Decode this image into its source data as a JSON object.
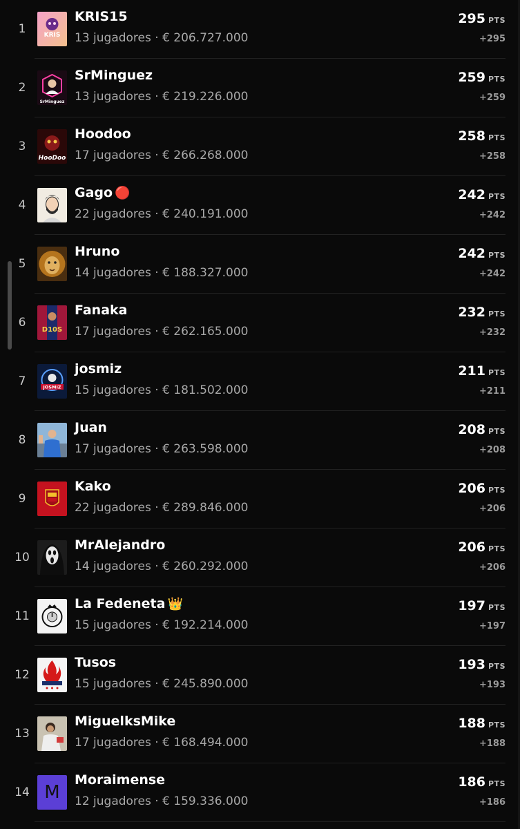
{
  "colors": {
    "background": "#0a0a0a",
    "text": "#ffffff",
    "muted": "#a8a8a8",
    "separator": "#222222"
  },
  "rows": [
    {
      "rank": "1",
      "name": "KRIS15",
      "emoji": "",
      "meta": "13 jugadores · € 206.727.000",
      "points": "295",
      "unit": "PTS",
      "delta": "+295",
      "avatar": "kris15-avatar",
      "avatar_text": "KRIS"
    },
    {
      "rank": "2",
      "name": "SrMinguez",
      "emoji": "",
      "meta": "13 jugadores · € 219.226.000",
      "points": "259",
      "unit": "PTS",
      "delta": "+259",
      "avatar": "srminguez-avatar",
      "avatar_text": "SrMinguez"
    },
    {
      "rank": "3",
      "name": "Hoodoo",
      "emoji": "",
      "meta": "17 jugadores · € 266.268.000",
      "points": "258",
      "unit": "PTS",
      "delta": "+258",
      "avatar": "hoodoo-avatar",
      "avatar_text": "HooDoo"
    },
    {
      "rank": "4",
      "name": "Gago",
      "emoji": "🔴",
      "meta": "22 jugadores · € 240.191.000",
      "points": "242",
      "unit": "PTS",
      "delta": "+242",
      "avatar": "gago-avatar",
      "avatar_text": ""
    },
    {
      "rank": "5",
      "name": "Hruno",
      "emoji": "",
      "meta": "14 jugadores · € 188.327.000",
      "points": "242",
      "unit": "PTS",
      "delta": "+242",
      "avatar": "hruno-avatar",
      "avatar_text": ""
    },
    {
      "rank": "6",
      "name": "Fanaka",
      "emoji": "",
      "meta": "17 jugadores · € 262.165.000",
      "points": "232",
      "unit": "PTS",
      "delta": "+232",
      "avatar": "fanaka-avatar",
      "avatar_text": "D10S"
    },
    {
      "rank": "7",
      "name": "josmiz",
      "emoji": "",
      "meta": "15 jugadores · € 181.502.000",
      "points": "211",
      "unit": "PTS",
      "delta": "+211",
      "avatar": "josmiz-avatar",
      "avatar_text": "JOSMIZ"
    },
    {
      "rank": "8",
      "name": "Juan",
      "emoji": "",
      "meta": "17 jugadores · € 263.598.000",
      "points": "208",
      "unit": "PTS",
      "delta": "+208",
      "avatar": "juan-avatar",
      "avatar_text": ""
    },
    {
      "rank": "9",
      "name": "Kako",
      "emoji": "",
      "meta": "22 jugadores · € 289.846.000",
      "points": "206",
      "unit": "PTS",
      "delta": "+206",
      "avatar": "kako-avatar",
      "avatar_text": ""
    },
    {
      "rank": "10",
      "name": "MrAlejandro",
      "emoji": "",
      "meta": "14 jugadores · € 260.292.000",
      "points": "206",
      "unit": "PTS",
      "delta": "+206",
      "avatar": "mralejandro-avatar",
      "avatar_text": ""
    },
    {
      "rank": "11",
      "name": "La Fedeneta",
      "emoji": "👑",
      "meta": "15 jugadores · € 192.214.000",
      "points": "197",
      "unit": "PTS",
      "delta": "+197",
      "avatar": "lafedeneta-avatar",
      "avatar_text": ""
    },
    {
      "rank": "12",
      "name": "Tusos",
      "emoji": "",
      "meta": "15 jugadores · € 245.890.000",
      "points": "193",
      "unit": "PTS",
      "delta": "+193",
      "avatar": "tusos-avatar",
      "avatar_text": ""
    },
    {
      "rank": "13",
      "name": "MiguelksMike",
      "emoji": "",
      "meta": "17 jugadores · € 168.494.000",
      "points": "188",
      "unit": "PTS",
      "delta": "+188",
      "avatar": "miguelksmike-avatar",
      "avatar_text": ""
    },
    {
      "rank": "14",
      "name": "Moraimense",
      "emoji": "",
      "meta": "12 jugadores · € 159.336.000",
      "points": "186",
      "unit": "PTS",
      "delta": "+186",
      "avatar": "moraimense-avatar",
      "avatar_text": "M"
    }
  ]
}
